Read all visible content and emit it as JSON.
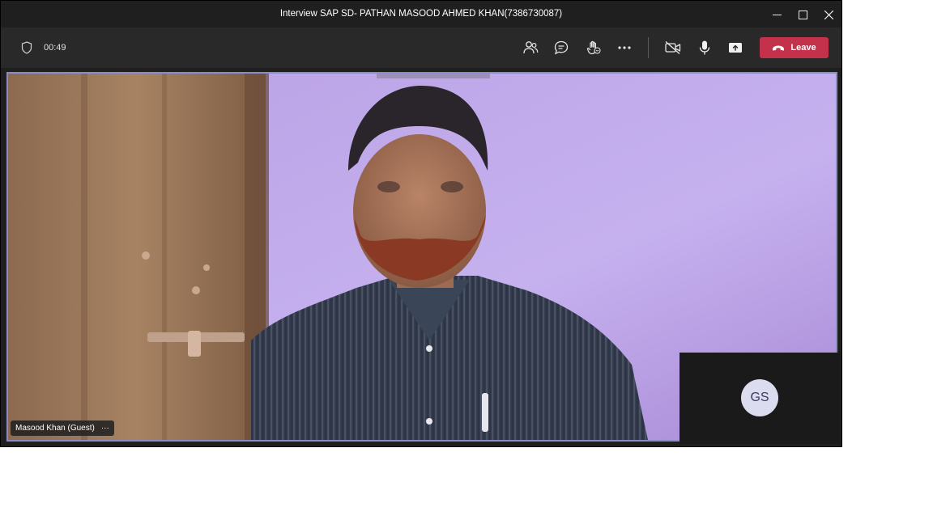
{
  "window": {
    "title": "Interview SAP SD- PATHAN MASOOD AHMED KHAN(7386730087)",
    "controls": [
      "minimize-icon",
      "maximize-icon",
      "close-icon"
    ]
  },
  "toolbar": {
    "timer": "00:49",
    "icons": [
      "shield-icon",
      "people-icon",
      "chat-icon",
      "raise-hand-icon",
      "more-icon",
      "camera-off-icon",
      "microphone-icon",
      "share-screen-icon",
      "phone-hangup-icon"
    ],
    "leave_label": "Leave",
    "leave_color": "#c4314b"
  },
  "stage": {
    "participant_name": "Masood Khan (Guest)",
    "more_label": "···",
    "self_initials": "GS",
    "active_speaker_border": "#8b8cc7"
  }
}
